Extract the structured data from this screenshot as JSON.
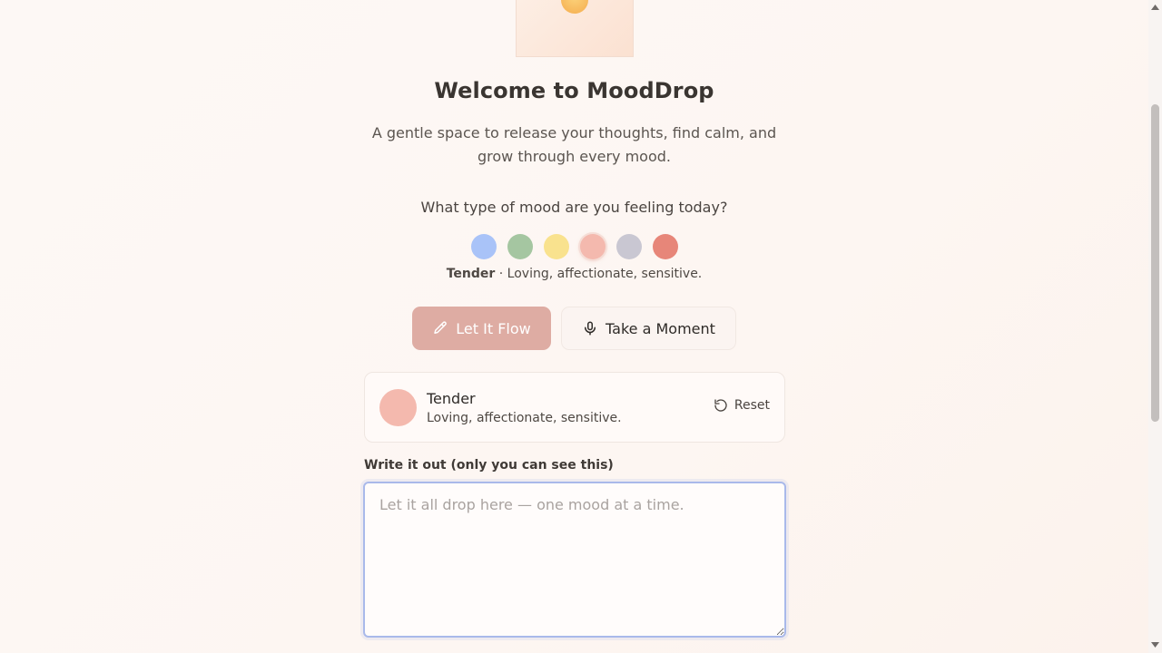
{
  "hero": {
    "image": "sunrise-illustration"
  },
  "title": "Welcome to MoodDrop",
  "subtitle": "A gentle space to release your thoughts, find calm, and grow through every mood.",
  "question": "What type of mood are you feeling today?",
  "moods": [
    {
      "color": "#a9c3f8"
    },
    {
      "color": "#a5c6a1"
    },
    {
      "color": "#f9e28e"
    },
    {
      "color": "#f4b9ae",
      "selected": true
    },
    {
      "color": "#c9c7d2"
    },
    {
      "color": "#e78679"
    }
  ],
  "selected_mood": {
    "name": "Tender",
    "separator": " · ",
    "description": "Loving, affectionate, sensitive."
  },
  "buttons": {
    "flow": {
      "label": "Let It Flow",
      "icon": "pencil-icon"
    },
    "moment": {
      "label": "Take a Moment",
      "icon": "microphone-icon"
    }
  },
  "card": {
    "name": "Tender",
    "description": "Loving, affectionate, sensitive.",
    "reset_label": "Reset",
    "reset_icon": "reset-icon"
  },
  "journal": {
    "label": "Write it out (only you can see this)",
    "placeholder": "Let it all drop here — one mood at a time.",
    "value": ""
  },
  "colors": {
    "accent": "#deaca3",
    "focus": "#a9b9ea",
    "text": "#3a3531"
  }
}
